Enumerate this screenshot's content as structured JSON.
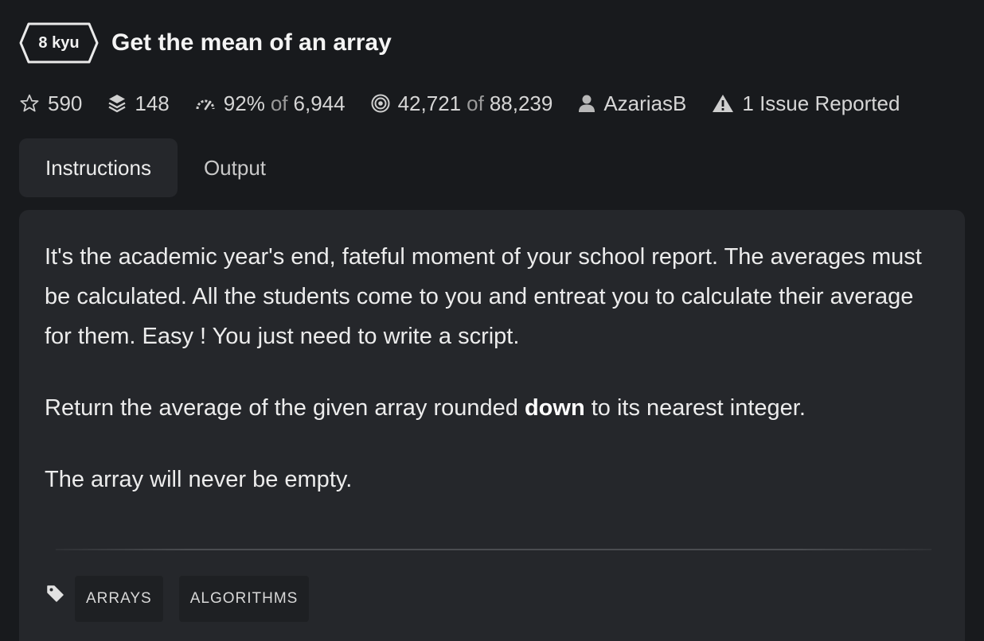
{
  "kata": {
    "rank": "8 kyu",
    "title": "Get the mean of an array"
  },
  "stats": {
    "stars": "590",
    "collections": "148",
    "satisfaction_pct": "92%",
    "satisfaction_of": "of",
    "satisfaction_total": "6,944",
    "completed": "42,721",
    "completed_of": "of",
    "attempted": "88,239",
    "author": "AzariasB",
    "issues": "1 Issue Reported"
  },
  "tabs": {
    "instructions": "Instructions",
    "output": "Output"
  },
  "description": {
    "p1": "It's the academic year's end, fateful moment of your school report. The averages must be calculated. All the students come to you and entreat you to calculate their average for them. Easy ! You just need to write a script.",
    "p2_before": "Return the average of the given array rounded ",
    "p2_bold": "down",
    "p2_after": " to its nearest integer.",
    "p3": "The array will never be empty."
  },
  "tags": [
    "ARRAYS",
    "ALGORITHMS"
  ],
  "icons": {
    "stars": "star-outline-icon",
    "collections": "layers-icon",
    "satisfaction": "gauge-icon",
    "completed": "target-icon",
    "author": "user-icon",
    "issues": "warning-icon",
    "tags": "tag-icon"
  },
  "colors": {
    "background": "#181a1d",
    "card": "#25272b",
    "tag_bg": "#1e2023",
    "text": "#ececec",
    "muted": "#9a9a9a"
  }
}
